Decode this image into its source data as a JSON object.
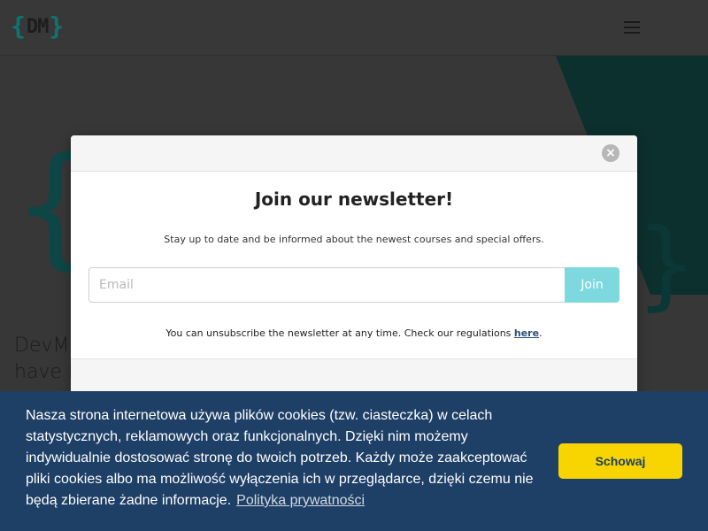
{
  "header": {
    "logo": {
      "left_brace": "{",
      "letters": "DM",
      "right_brace": "}"
    },
    "menu_icon": "hamburger-menu-icon"
  },
  "hero": {
    "text_line1": "DevMe",
    "text_line2": "have b"
  },
  "newsletter": {
    "close_label": "×",
    "title": "Join our newsletter!",
    "subtitle": "Stay up to date and be informed about the newest courses and special offers.",
    "email_placeholder": "Email",
    "join_label": "Join",
    "note_text": "You can unsubscribe the newsletter at any time. Check our regulations",
    "note_link": "here",
    "note_end": "."
  },
  "cookies": {
    "text": "Nasza strona internetowa używa plików cookies (tzw. ciasteczka) w celach statystycznych, reklamowych oraz funkcjonalnych. Dzięki nim możemy indywidualnie dostosować stronę do twoich potrzeb. Każdy może zaakceptować pliki cookies albo ma możliwość wyłączenia ich w przeglądarce, dzięki czemu nie będą zbierane żadne informacje.",
    "link": "Polityka prywatności",
    "button": "Schowaj"
  },
  "colors": {
    "brand_teal": "#127a78",
    "cookie_bar": "#1e3f66",
    "cookie_button": "#f8d500",
    "join_button": "#7dd9de"
  }
}
